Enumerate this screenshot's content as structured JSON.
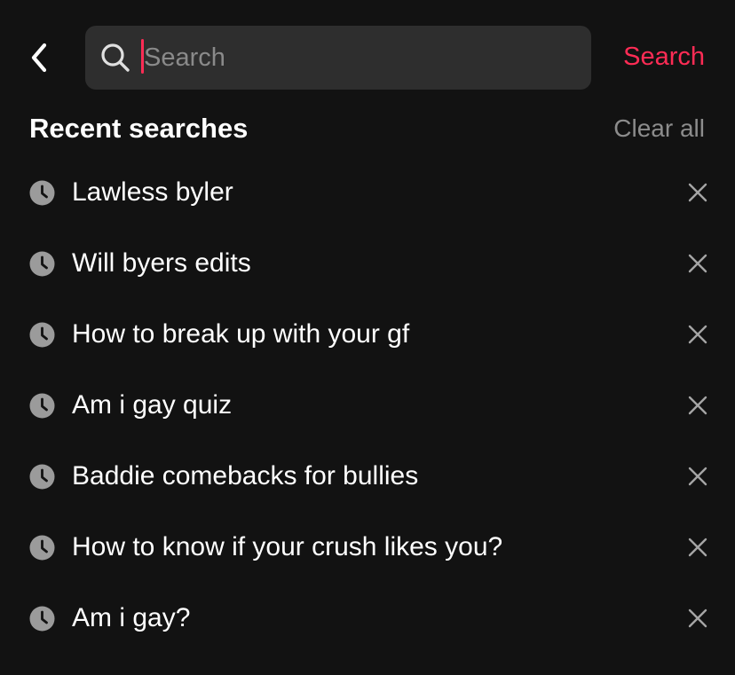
{
  "header": {
    "back_icon": "chevron-left-icon",
    "search_placeholder": "Search",
    "search_value": "",
    "search_icon": "search-icon",
    "submit_label": "Search",
    "accent_color": "#fe2c55"
  },
  "recent": {
    "title": "Recent searches",
    "clear_label": "Clear all",
    "items": [
      {
        "label": "Lawless byler"
      },
      {
        "label": "Will byers edits"
      },
      {
        "label": "How to break up with your gf"
      },
      {
        "label": "Am i gay quiz"
      },
      {
        "label": "Baddie comebacks for bullies"
      },
      {
        "label": "How to know if your crush likes you?"
      },
      {
        "label": "Am i gay?"
      }
    ],
    "item_icon": "clock-icon",
    "remove_icon": "close-icon"
  }
}
